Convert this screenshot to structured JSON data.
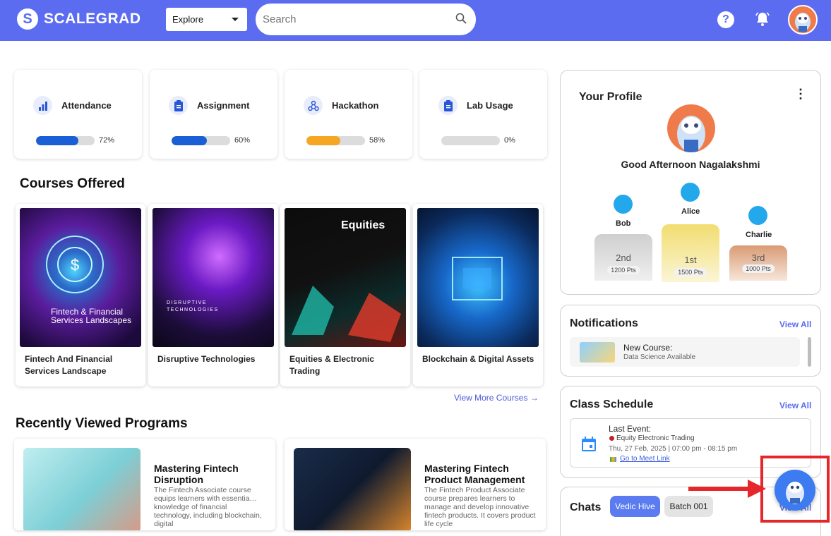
{
  "header": {
    "brand": "SCALEGRAD",
    "explore_label": "Explore",
    "search_placeholder": "Search"
  },
  "stats": [
    {
      "title": "Attendance",
      "percent_label": "72%",
      "percent": 72,
      "color": "#1a5fd6"
    },
    {
      "title": "Assignment",
      "percent_label": "60%",
      "percent": 60,
      "color": "#1a5fd6"
    },
    {
      "title": "Hackathon",
      "percent_label": "58%",
      "percent": 58,
      "color": "#f5a623"
    },
    {
      "title": "Lab Usage",
      "percent_label": "0%",
      "percent": 0,
      "color": "#1a5fd6"
    }
  ],
  "courses": {
    "title": "Courses Offered",
    "items": [
      {
        "name": "Fintech And Financial Services Landscape",
        "cover_text": "Fintech & Financial Services Landscapes"
      },
      {
        "name": "Disruptive Technologies",
        "cover_text": "DISRUPTIVE TECHNOLOGIES"
      },
      {
        "name": "Equities & Electronic Trading",
        "cover_text": "Equities"
      },
      {
        "name": "Blockchain & Digital Assets",
        "cover_text": ""
      }
    ],
    "view_more": "View More Courses →"
  },
  "programs": {
    "title": "Recently Viewed Programs",
    "items": [
      {
        "title": "Mastering Fintech Disruption",
        "desc": "The Fintech Associate course equips learners with essentia… knowledge of financial technology, including blockchain, digital"
      },
      {
        "title": "Mastering Fintech Product Management",
        "desc": "The Fintech Product Associate course prepares learners to manage and develop innovative fintech products. It covers product life cycle"
      }
    ]
  },
  "profile": {
    "title": "Your Profile",
    "greeting": "Good Afternoon Nagalakshmi",
    "leaders": [
      {
        "name": "Bob",
        "rank": "2nd",
        "points": "1200 Pts"
      },
      {
        "name": "Alice",
        "rank": "1st",
        "points": "1500 Pts"
      },
      {
        "name": "Charlie",
        "rank": "3rd",
        "points": "1000 Pts"
      }
    ]
  },
  "notifications": {
    "title": "Notifications",
    "view_all": "View All",
    "item_title": "New Course:",
    "item_sub": "Data Science Available"
  },
  "schedule": {
    "title": "Class Schedule",
    "view_all": "View All",
    "event_label": "Last Event:",
    "event_name": "Equity Electronic Trading",
    "event_time": "Thu, 27 Feb, 2025 | 07:00 pm - 08:15 pm",
    "meet_link": "Go to Meet Link"
  },
  "chats": {
    "title": "Chats",
    "chips": [
      "Vedic Hive",
      "Batch 001"
    ],
    "view_all": "View All"
  }
}
